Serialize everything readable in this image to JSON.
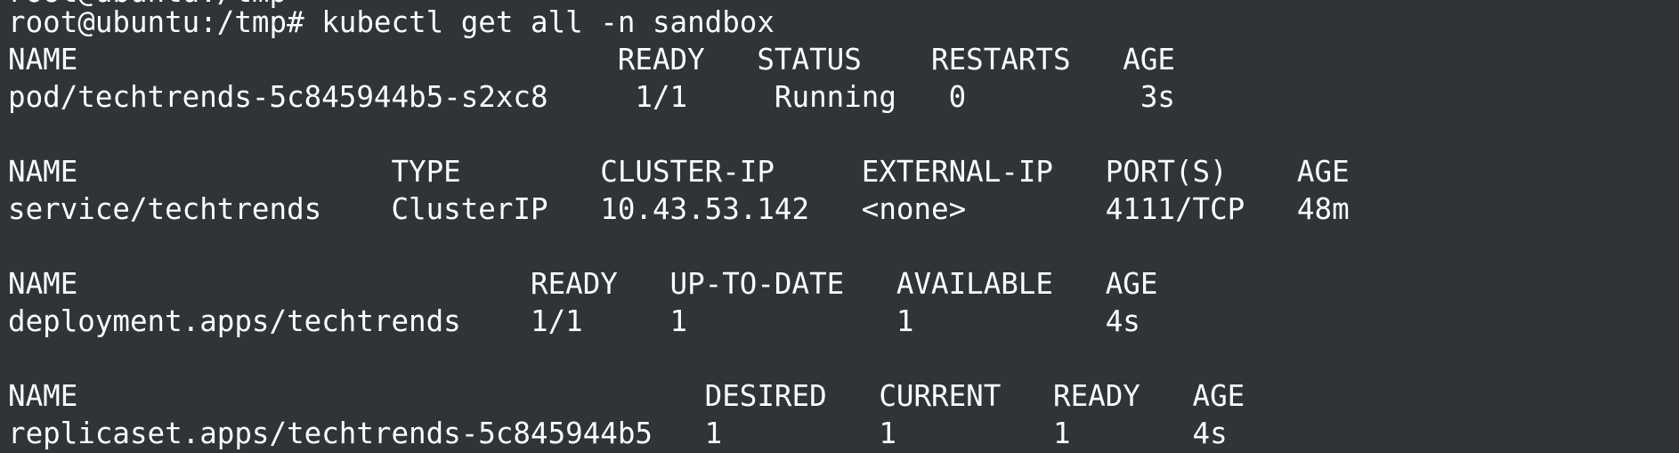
{
  "terminal": {
    "background": "#2e3437",
    "foreground": "#ffffff",
    "prompt": "root@ubuntu:/tmp# ",
    "command": "kubectl get all -n sandbox",
    "top_clipped": "root@ubuntu:/tmp",
    "pods": {
      "header": "NAME                               READY   STATUS    RESTARTS   AGE",
      "row": "pod/techtrends-5c845944b5-s2xc8     1/1     Running   0          3s"
    },
    "services": {
      "header": "NAME                  TYPE        CLUSTER-IP     EXTERNAL-IP   PORT(S)    AGE",
      "row": "service/techtrends    ClusterIP   10.43.53.142   <none>        4111/TCP   48m"
    },
    "deployments": {
      "header": "NAME                          READY   UP-TO-DATE   AVAILABLE   AGE",
      "row": "deployment.apps/techtrends    1/1     1            1           4s"
    },
    "replicasets": {
      "header": "NAME                                    DESIRED   CURRENT   READY   AGE",
      "row": "replicaset.apps/techtrends-5c845944b5   1         1         1       4s"
    }
  }
}
